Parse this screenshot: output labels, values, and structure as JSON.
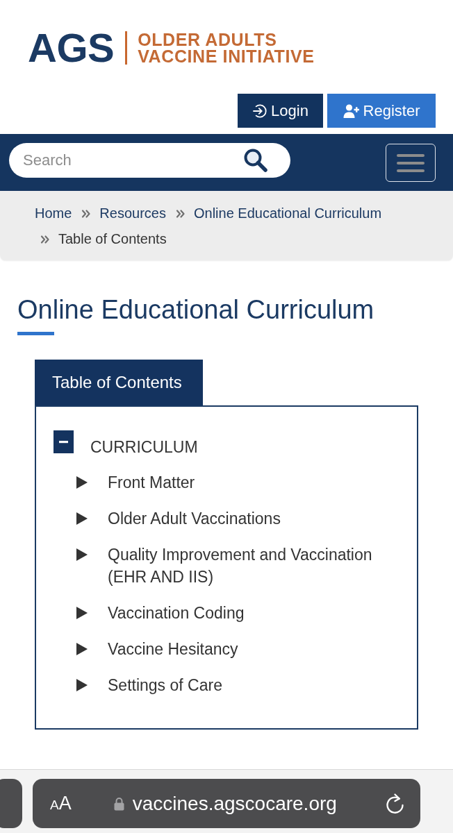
{
  "logo": {
    "mark": "AGS",
    "tagline": [
      "OLDER ADULTS",
      "VACCINE INITIATIVE"
    ]
  },
  "account_buttons": [
    {
      "kind": "login",
      "label": "Login"
    },
    {
      "kind": "register",
      "label": "Register"
    }
  ],
  "navbar": {
    "search": {
      "placeholder": "Search"
    }
  },
  "breadcrumb": [
    {
      "kind": "link",
      "label": "Home"
    },
    {
      "kind": "link",
      "label": "Resources"
    },
    {
      "kind": "link",
      "label": "Online Educational Curriculum"
    },
    {
      "kind": "current",
      "label": "Table of Contents"
    }
  ],
  "page_title": "Online Educational Curriculum",
  "toc": {
    "tab": "Table of Contents",
    "tree": [
      {
        "label": "CURRICULUM",
        "expanded": true,
        "children": [
          {
            "label": "Front Matter",
            "expanded": false
          },
          {
            "label": "Older Adult Vaccinations",
            "expanded": false
          },
          {
            "label": "Quality Improvement and Vaccination (EHR AND IIS)",
            "expanded": false
          },
          {
            "label": "Vaccination Coding",
            "expanded": false
          },
          {
            "label": "Vaccine Hesitancy",
            "expanded": false
          },
          {
            "label": "Settings of Care",
            "expanded": false
          }
        ]
      }
    ]
  },
  "browser": {
    "text_size": "AA",
    "url": "vaccines.agscocare.org"
  }
}
